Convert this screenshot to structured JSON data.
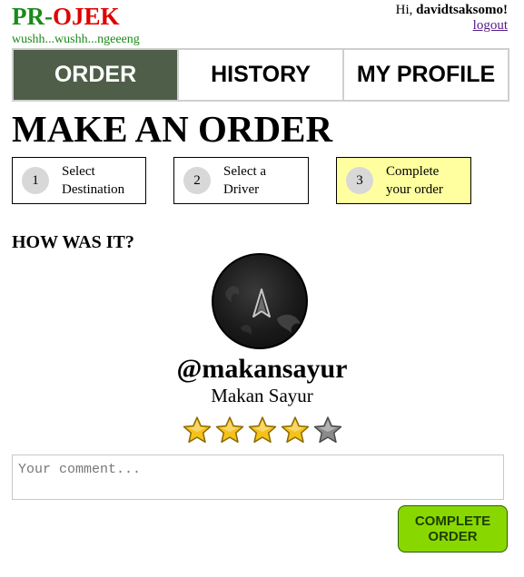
{
  "header": {
    "logo_pr": "PR",
    "logo_dash": "-",
    "logo_ojek": "OJEK",
    "tagline": "wushh...wushh...ngeeeng",
    "greeting_prefix": "Hi, ",
    "username": "davidtsaksomo!",
    "logout_label": "logout"
  },
  "tabs": [
    {
      "label": "ORDER",
      "active": true
    },
    {
      "label": "HISTORY",
      "active": false
    },
    {
      "label": "MY PROFILE",
      "active": false
    }
  ],
  "page_title": "MAKE AN ORDER",
  "steps": [
    {
      "number": "1",
      "label": "Select\nDestination",
      "active": false
    },
    {
      "number": "2",
      "label": "Select a\nDriver",
      "active": false
    },
    {
      "number": "3",
      "label": "Complete\nyour order",
      "active": true
    }
  ],
  "rating": {
    "heading": "HOW WAS IT?",
    "driver_username": "@makansayur",
    "driver_name": "Makan Sayur",
    "stars_filled": 4,
    "stars_total": 5,
    "comment_placeholder": "Your comment...",
    "comment_value": "",
    "submit_label": "COMPLETE\nORDER"
  },
  "colors": {
    "active_tab": "#4e5e48",
    "active_step": "#ffffa0",
    "submit_button": "#88d800",
    "logo_green": "#1a8a1a",
    "logo_red": "#e00000",
    "star_filled": "#f5c21b",
    "star_empty": "#8a8a8a"
  }
}
